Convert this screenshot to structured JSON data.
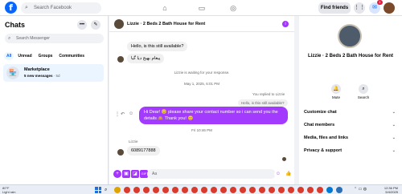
{
  "topbar": {
    "logo": "f",
    "search_placeholder": "Search Facebook",
    "find_friends": "Find friends",
    "notif_badge": "1"
  },
  "left": {
    "title": "Chats",
    "search_placeholder": "Search Messenger",
    "filters": [
      "All",
      "Unread",
      "Groups",
      "Communities"
    ],
    "conversation": {
      "name": "Marketplace",
      "subtitle": "5 new messages",
      "time": "· 5d"
    }
  },
  "chat": {
    "title": "Lizzie · 2 Beds 2 Bath House for Rent",
    "messages": {
      "m1": "Hello, is this still available?",
      "m2": "پیغام بھیج دیا گیا",
      "waiting": "Lizzie is waiting for your response.",
      "date1": "May 1, 2025, 6:01 PM",
      "replied_to": "You replied to Lizzie",
      "quoted": "Hello, is this still available?",
      "out_msg": "Hi Dear! 😊 please share your contact number     so i can send you the details 🙈 Thank you! 😊",
      "date2": "Fri 10:46 PM",
      "sender": "Lizzie",
      "phone": "6089177888"
    },
    "composer_placeholder": "Aa"
  },
  "right": {
    "name": "Lizzie · 2 Beds 2 Bath House for Rent",
    "actions": [
      "Mute",
      "Search"
    ],
    "sections": [
      "Customize chat",
      "Chat members",
      "Media, files and links",
      "Privacy & support"
    ]
  },
  "taskbar": {
    "temp": "80°F",
    "weather": "Light rain",
    "time": "12:36 PM",
    "date": "5/4/2025"
  }
}
